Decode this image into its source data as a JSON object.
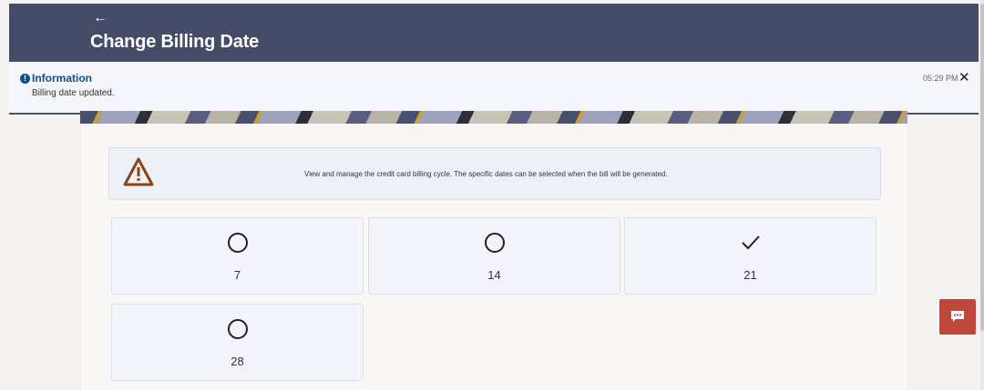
{
  "header": {
    "back_icon": "arrow-left-icon",
    "back_glyph": "←",
    "title": "Change Billing Date"
  },
  "notification": {
    "icon": "info-icon",
    "icon_glyph": "!",
    "title": "Information",
    "message": "Billing date updated.",
    "time": "05:29 PM",
    "close_glyph": "✕"
  },
  "notice": {
    "icon": "warning-icon",
    "text": "View and manage the credit card billing cycle. The specific dates can be selected when the bill will be generated."
  },
  "billing_options": [
    {
      "label": "7",
      "selected": false
    },
    {
      "label": "14",
      "selected": false
    },
    {
      "label": "21",
      "selected": true
    },
    {
      "label": "28",
      "selected": false
    }
  ],
  "chat": {
    "icon": "chat-icon"
  },
  "colors": {
    "header_bg": "#464b68",
    "info_accent": "#154d7d",
    "warning": "#8b4513",
    "chat_bg": "#c0473a"
  }
}
